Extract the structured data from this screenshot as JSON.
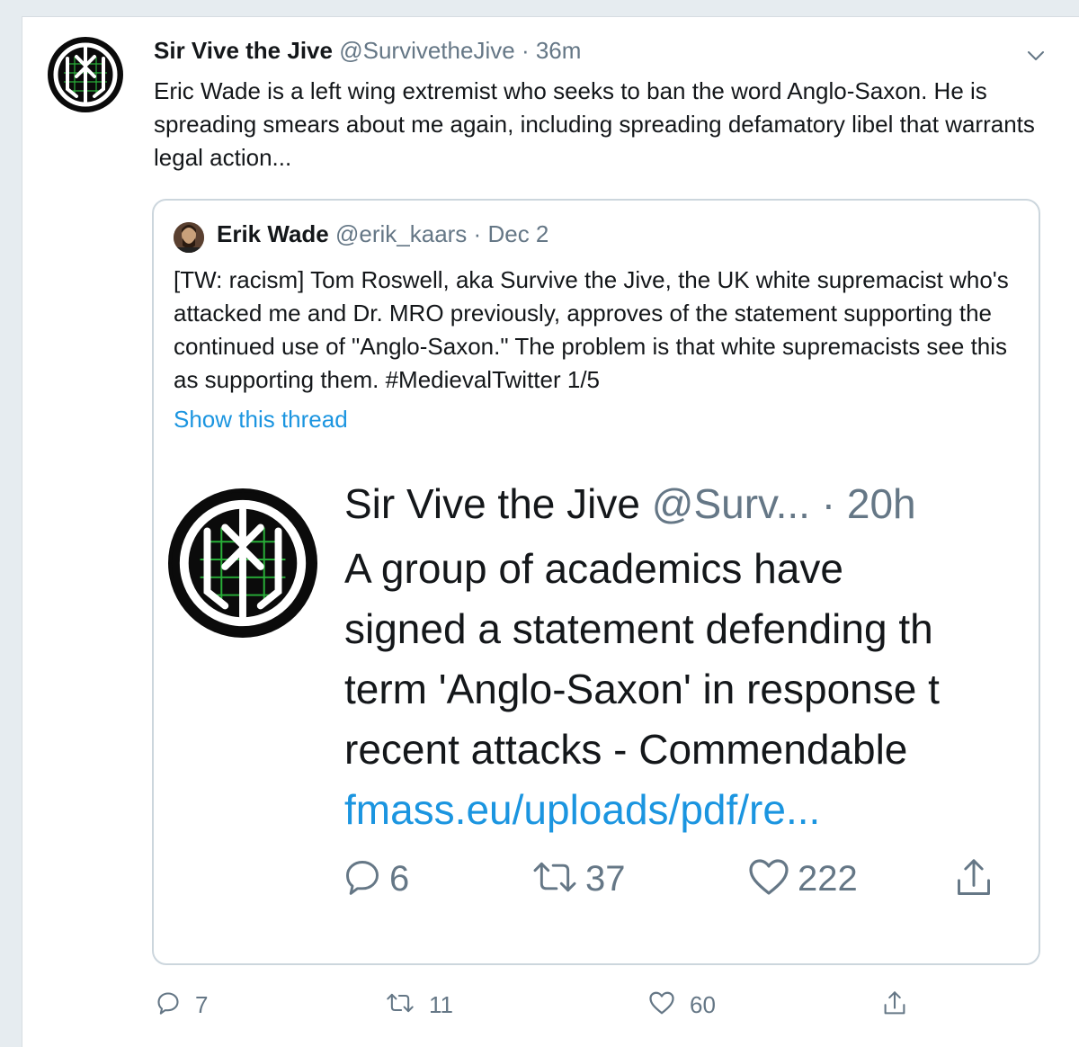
{
  "tweet": {
    "author_name": "Sir Vive the Jive",
    "author_handle": "@SurvivetheJive",
    "separator": "·",
    "time": "36m",
    "text": "Eric Wade is a left wing extremist who seeks to ban the word Anglo-Saxon. He is spreading smears about me again, including spreading defamatory libel that warrants legal action...",
    "replies": "7",
    "retweets": "11",
    "likes": "60"
  },
  "quoted": {
    "author_name": "Erik Wade",
    "author_handle": "@erik_kaars",
    "separator": "·",
    "time": "Dec 2",
    "text": "[TW: racism] Tom Roswell, aka Survive the Jive, the UK white supremacist who's attacked me and Dr. MRO previously, approves of the statement supporting the continued use of \"Anglo-Saxon.\" The problem is that white supremacists see this as supporting them. #MedievalTwitter 1/5",
    "show_thread": "Show this thread"
  },
  "embedded": {
    "author_name": "Sir Vive the Jive",
    "author_handle": "@Surv...",
    "separator": "·",
    "time": "20h",
    "lines": [
      "A group of academics have",
      "signed a statement defending th",
      "term 'Anglo-Saxon' in response t",
      "recent attacks - Commendable"
    ],
    "link": "fmass.eu/uploads/pdf/re...",
    "replies": "6",
    "retweets": "37",
    "likes": "222"
  },
  "icons": {
    "reply": "reply-icon",
    "retweet": "retweet-icon",
    "like": "like-icon",
    "share": "share-icon",
    "menu": "chevron-down-icon"
  },
  "colors": {
    "link": "#1b95e0",
    "muted": "#657786",
    "border": "#ccd6dd"
  }
}
